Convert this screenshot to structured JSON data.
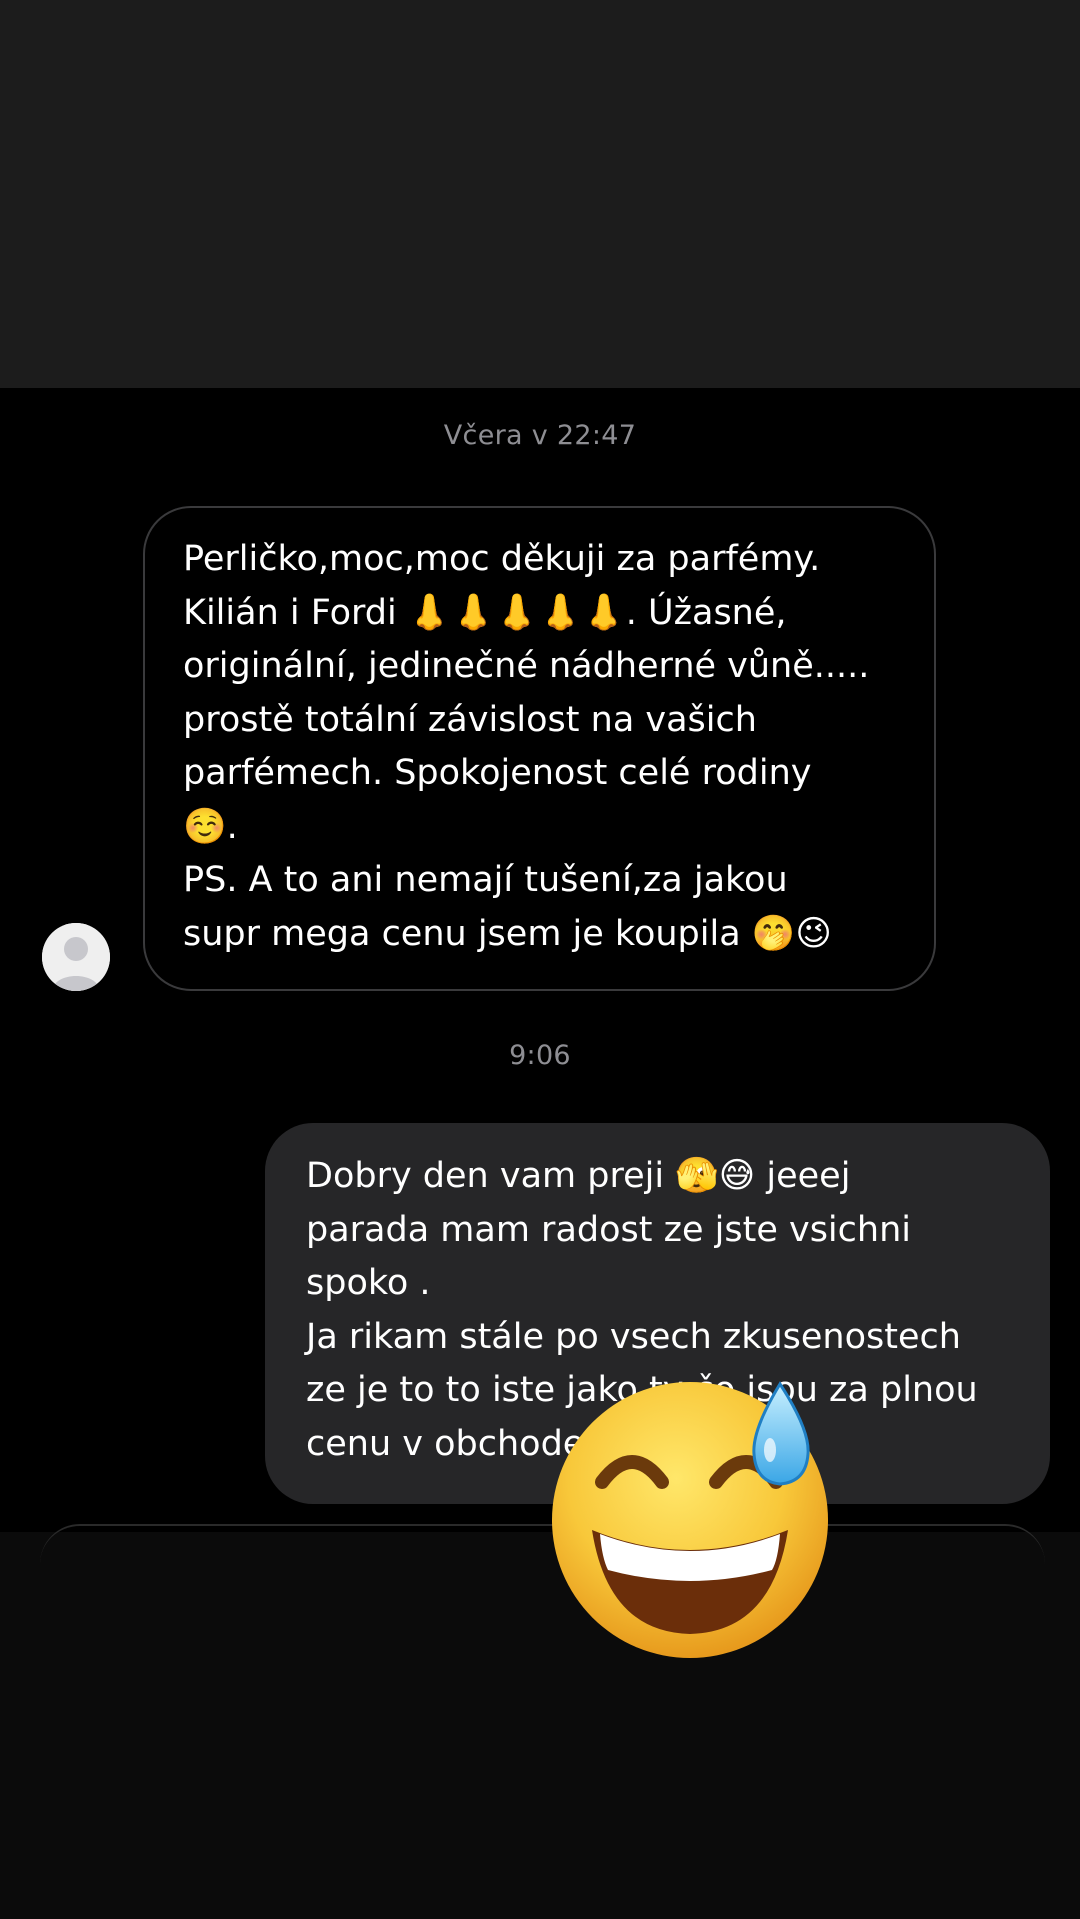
{
  "chat": {
    "timestamp_1": "Včera v 22:47",
    "received_message": "Perličko,moc,moc děkuji za parfémy.\nKilián i Fordi 👃👃👃👃👃.  Úžasné,\noriginální, jedinečné nádherné vůně.....\nprostě totální závislost na vašich\nparfémech. Spokojenost celé rodiny\n☺️.\nPS. A to ani nemají tušení,za jakou\nsupr mega cenu jsem je koupila 🤭😉",
    "timestamp_2": "9:06",
    "sent_message": "Dobry den vam preji 🫣😅 jeeej\nparada mam radost ze jste vsichni\nspoko .\nJa rikam stále po vsech zkusenostech\nze je to to iste jako ty čo jsou za plnou\ncenu v obchode"
  },
  "sticker": {
    "icon": "grinning-sweat-emoji-icon"
  },
  "colors": {
    "top_band": "#1c1c1c",
    "chat_background": "#000000",
    "received_bubble_border": "#3a3a3c",
    "sent_bubble_background": "#262628",
    "timestamp_text": "#8e8e93",
    "message_text": "#ffffff"
  }
}
